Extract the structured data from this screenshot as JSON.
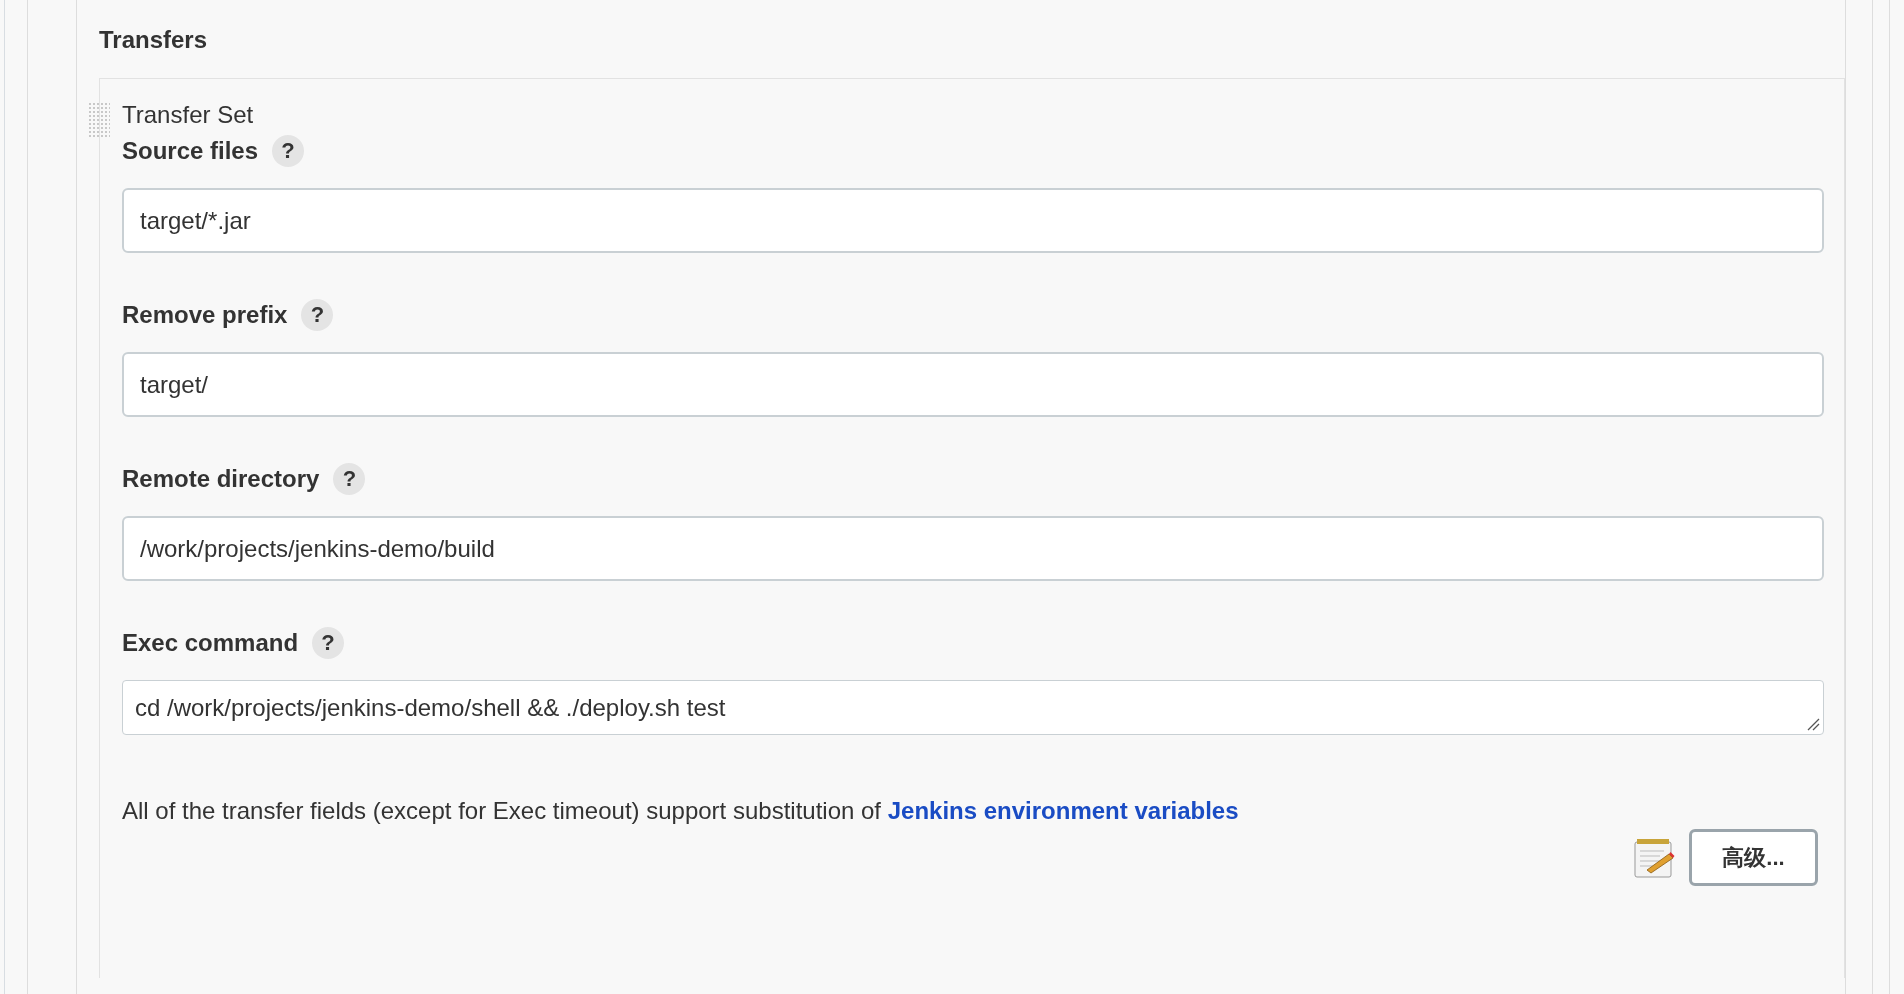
{
  "section_title": "Transfers",
  "transfer_set": {
    "title": "Transfer Set",
    "fields": [
      {
        "kind": "input",
        "label": "Source files",
        "help": "?",
        "value": "target/*.jar"
      },
      {
        "kind": "input",
        "label": "Remove prefix",
        "help": "?",
        "value": "target/"
      },
      {
        "kind": "input",
        "label": "Remote directory",
        "help": "?",
        "value": "/work/projects/jenkins-demo/build"
      },
      {
        "kind": "textarea",
        "label": "Exec command",
        "help": "?",
        "value": "cd /work/projects/jenkins-demo/shell && ./deploy.sh test"
      }
    ],
    "note": {
      "text": "All of the transfer fields (except for Exec timeout) support substitution of",
      "link": "Jenkins environment variables"
    },
    "advanced_button": "高级..."
  }
}
